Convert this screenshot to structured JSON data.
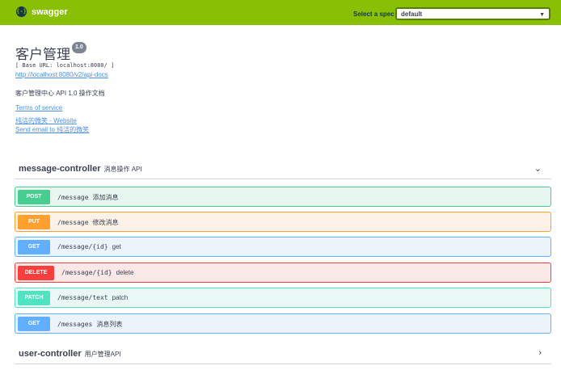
{
  "topbar": {
    "logo_glyph": "{-}",
    "logo_text": "swagger",
    "spec_label": "Select a spec",
    "spec_value": "default",
    "color": "#89bf04"
  },
  "info": {
    "title": "客户管理",
    "version": "1.0",
    "base_url": "[ Base URL: localhost:8080/ ]",
    "api_docs_link": "http://localhost:8080/v2/api-docs",
    "description": "客户管理中心 API 1.0 操作文档",
    "terms": "Terms of service",
    "website": "纯洁的微笑 - Website",
    "email": "Send email to 纯洁的微笑"
  },
  "tags": [
    {
      "name": "message-controller",
      "description": "消息操作 API",
      "expanded": true,
      "chevron": "⌄"
    },
    {
      "name": "user-controller",
      "description": "用户管理API",
      "expanded": false,
      "chevron": "›"
    }
  ],
  "operations": [
    {
      "method": "POST",
      "path": "/message",
      "summary": "添加消息",
      "color": "#49cc90",
      "bg": "#e8f6f0",
      "border": "#49cc90"
    },
    {
      "method": "PUT",
      "path": "/message",
      "summary": "修改消息",
      "color": "#fca130",
      "bg": "#fbf1e6",
      "border": "#fca130"
    },
    {
      "method": "GET",
      "path": "/message/{id}",
      "summary": "get",
      "color": "#61affe",
      "bg": "#ebf3fb",
      "border": "#61affe"
    },
    {
      "method": "DELETE",
      "path": "/message/{id}",
      "summary": "delete",
      "color": "#f93e3e",
      "bg": "#fae7e7",
      "border": "#f93e3e"
    },
    {
      "method": "PATCH",
      "path": "/message/text",
      "summary": "patch",
      "color": "#50e3c2",
      "bg": "#e9f8f5",
      "border": "#50e3c2"
    },
    {
      "method": "GET",
      "path": "/messages",
      "summary": "消息列表",
      "color": "#61affe",
      "bg": "#ebf3fb",
      "border": "#61affe"
    }
  ]
}
